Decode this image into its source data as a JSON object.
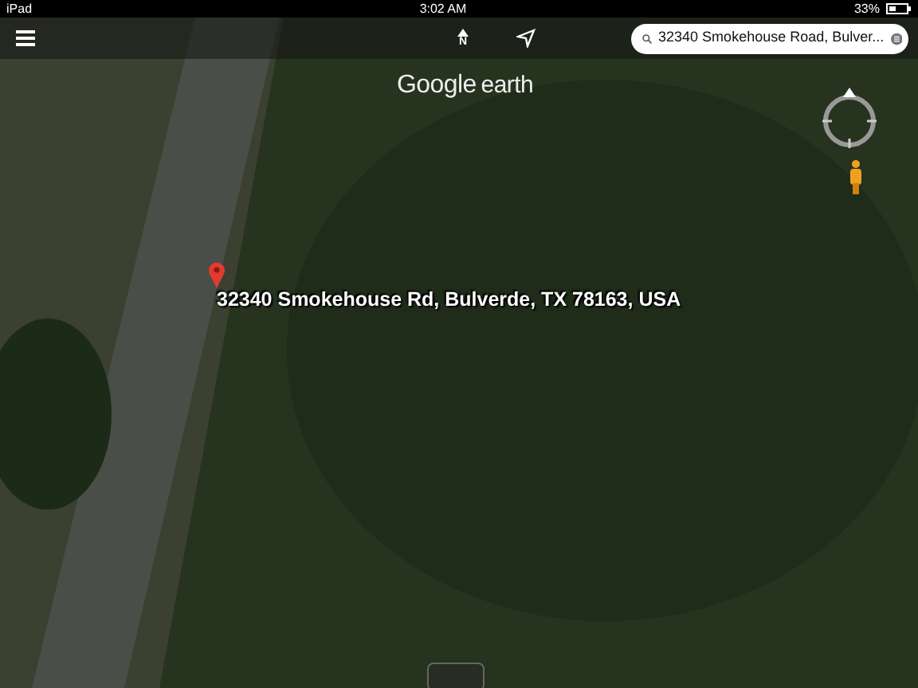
{
  "status_bar": {
    "device": "iPad",
    "time": "3:02 AM",
    "battery": "33%"
  },
  "toolbar": {
    "north_label": "N",
    "search": {
      "value": "32340 Smokehouse Road, Bulver..."
    }
  },
  "logo": {
    "brand": "Google",
    "product": "earth"
  },
  "placemark": {
    "label": "32340 Smokehouse Rd, Bulverde, TX 78163, USA"
  }
}
